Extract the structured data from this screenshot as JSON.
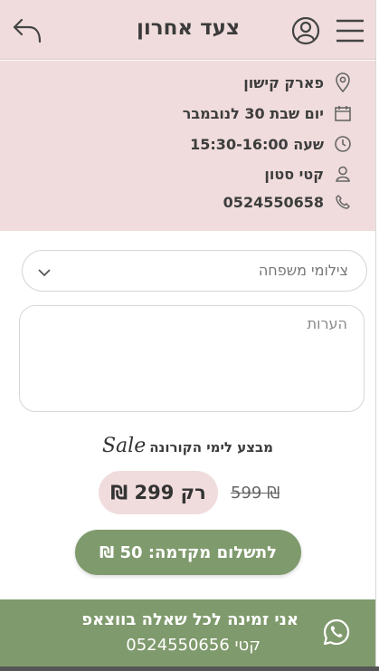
{
  "header": {
    "title": "צעד אחרון"
  },
  "info": {
    "location": "פארק קישון",
    "date": "יום שבת 30 לנובמבר",
    "time": "שעה 15:30-16:00",
    "contact_name": "קטי סטון",
    "phone": "0524550658"
  },
  "form": {
    "service_select_value": "צילומי משפחה",
    "notes_placeholder": "הערות"
  },
  "promo": {
    "text": "מבצע לימי הקורונה",
    "sale_word": "Sale",
    "old_price": "599 ₪",
    "new_price": "רק 299 ₪"
  },
  "deposit": {
    "label": "לתשלום מקדמה: 50 ₪"
  },
  "whatsapp": {
    "line1": "אני זמינה לכל שאלה בווצאפ",
    "line2": "קטי 0524550656"
  },
  "colors": {
    "pink": "#f0dcdc",
    "green": "#7f9a6c"
  }
}
